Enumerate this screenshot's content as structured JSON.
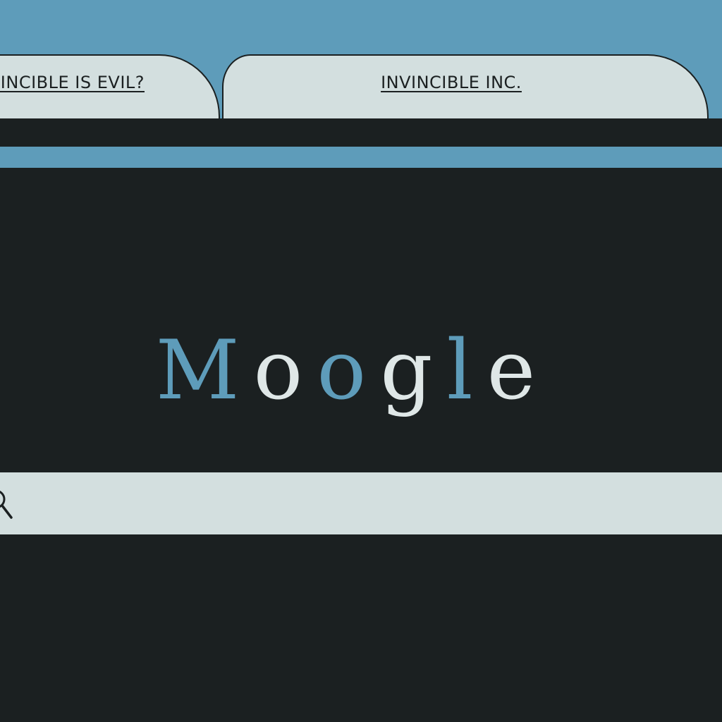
{
  "tabs": [
    {
      "label": "INVINCIBLE IS EVIL?"
    },
    {
      "label": "INVINCIBLE INC."
    }
  ],
  "logo": {
    "letters": [
      {
        "char": "M",
        "color": "#5e9cba"
      },
      {
        "char": "o",
        "color": "#dfe7e7"
      },
      {
        "char": "o",
        "color": "#5e9cba"
      },
      {
        "char": "g",
        "color": "#dfe7e7"
      },
      {
        "char": "l",
        "color": "#5e9cba"
      },
      {
        "char": "e",
        "color": "#dfe7e7"
      }
    ]
  },
  "search": {
    "value": "",
    "placeholder": "",
    "icon": "search-icon"
  },
  "colors": {
    "background": "#1b2021",
    "accent": "#5e9cba",
    "surface": "#d3dfdf"
  }
}
